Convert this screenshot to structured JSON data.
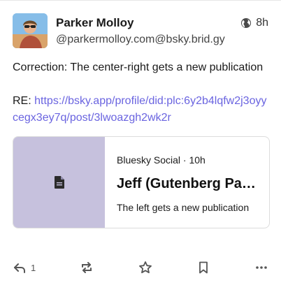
{
  "post": {
    "display_name": "Parker Molloy",
    "handle": "@parkermolloy.com@bsky.brid.gy",
    "visibility_icon": "globe-icon",
    "timestamp": "8h",
    "text_line1": "Correction: The center-right gets a new publication",
    "text_re_prefix": "RE: ",
    "text_link": "https://bsky.app/profile/did:plc:6y2b4lqfw2j3oyycegx3ey7q/post/3lwoazgh2wk2r",
    "link_color": "#6a64e0"
  },
  "link_card": {
    "thumb_icon": "document-icon",
    "thumb_color": "#c6c1dd",
    "source": "Bluesky Social · 10h",
    "title": "Jeff (Gutenberg Parker)",
    "description": "The left gets a new publication"
  },
  "actions": {
    "reply_icon": "reply-icon",
    "reply_count": "1",
    "boost_icon": "repost-icon",
    "favorite_icon": "star-icon",
    "bookmark_icon": "bookmark-icon",
    "more_icon": "more-dots-icon"
  }
}
